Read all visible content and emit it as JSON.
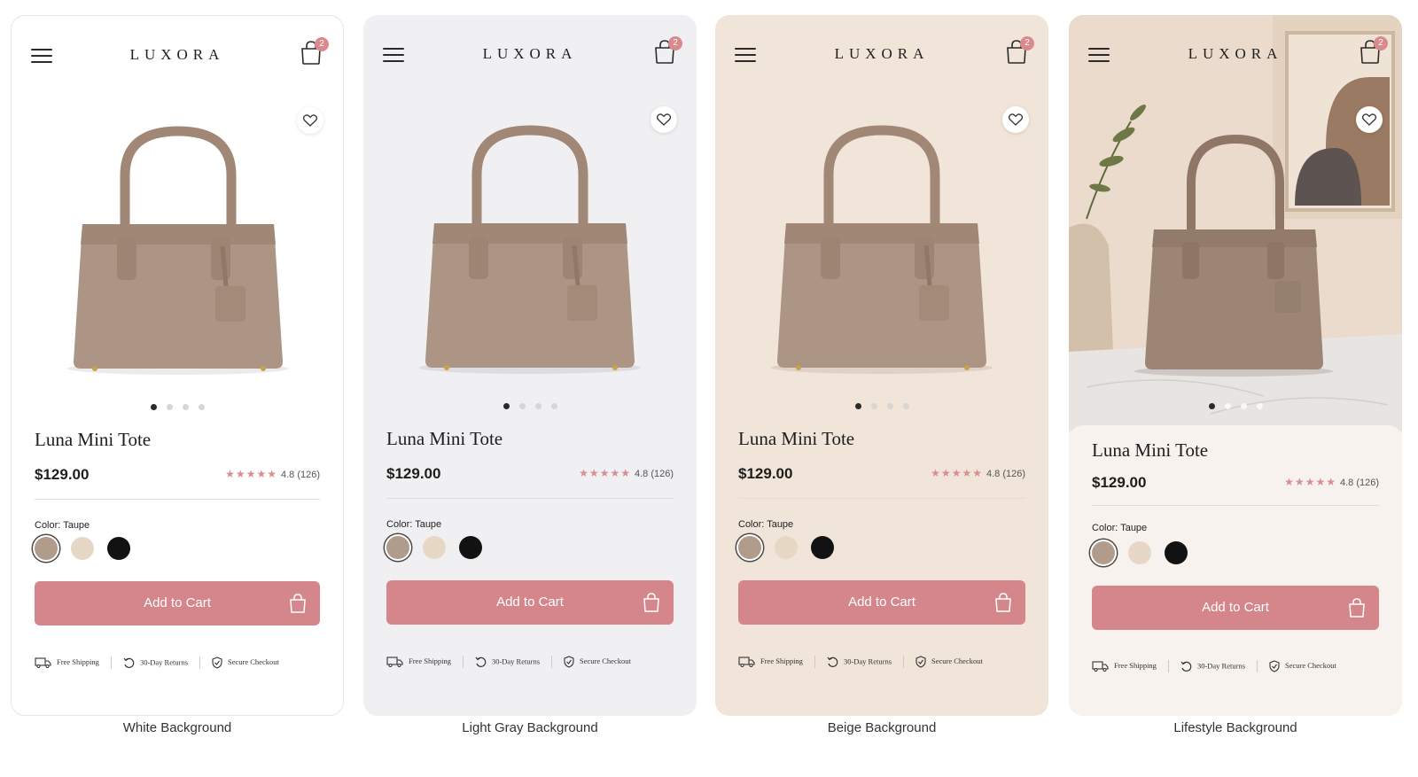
{
  "shared": {
    "brand": "LUXORA",
    "cart_count": "2",
    "product_title": "Luna Mini Tote",
    "price": "$129.00",
    "stars": "★★★★★",
    "rating": "4.8 (126)",
    "color_label": "Color: Taupe",
    "add_to_cart": "Add to Cart",
    "features": {
      "shipping": "Free Shipping",
      "returns": "30-Day Returns",
      "checkout": "Secure Checkout"
    },
    "swatches": [
      {
        "name": "taupe",
        "color": "#b19b8b",
        "selected": true
      },
      {
        "name": "cream",
        "color": "#e7d8c5",
        "selected": false
      },
      {
        "name": "black",
        "color": "#121212",
        "selected": false
      }
    ],
    "carousel": {
      "total": 4,
      "active": 1
    },
    "colors": {
      "accent": "#d4868b",
      "badge": "#d98a8e",
      "taupe": "#a48a79"
    }
  },
  "variants": [
    {
      "id": "white",
      "caption": "White Background",
      "bg": "#ffffff"
    },
    {
      "id": "gray",
      "caption": "Light Gray Background",
      "bg": "#f0f0f2"
    },
    {
      "id": "beige",
      "caption": "Beige Background",
      "bg": "#f1e4d9"
    },
    {
      "id": "life",
      "caption": "Lifestyle Background",
      "bg": "#f7f2ee"
    }
  ]
}
